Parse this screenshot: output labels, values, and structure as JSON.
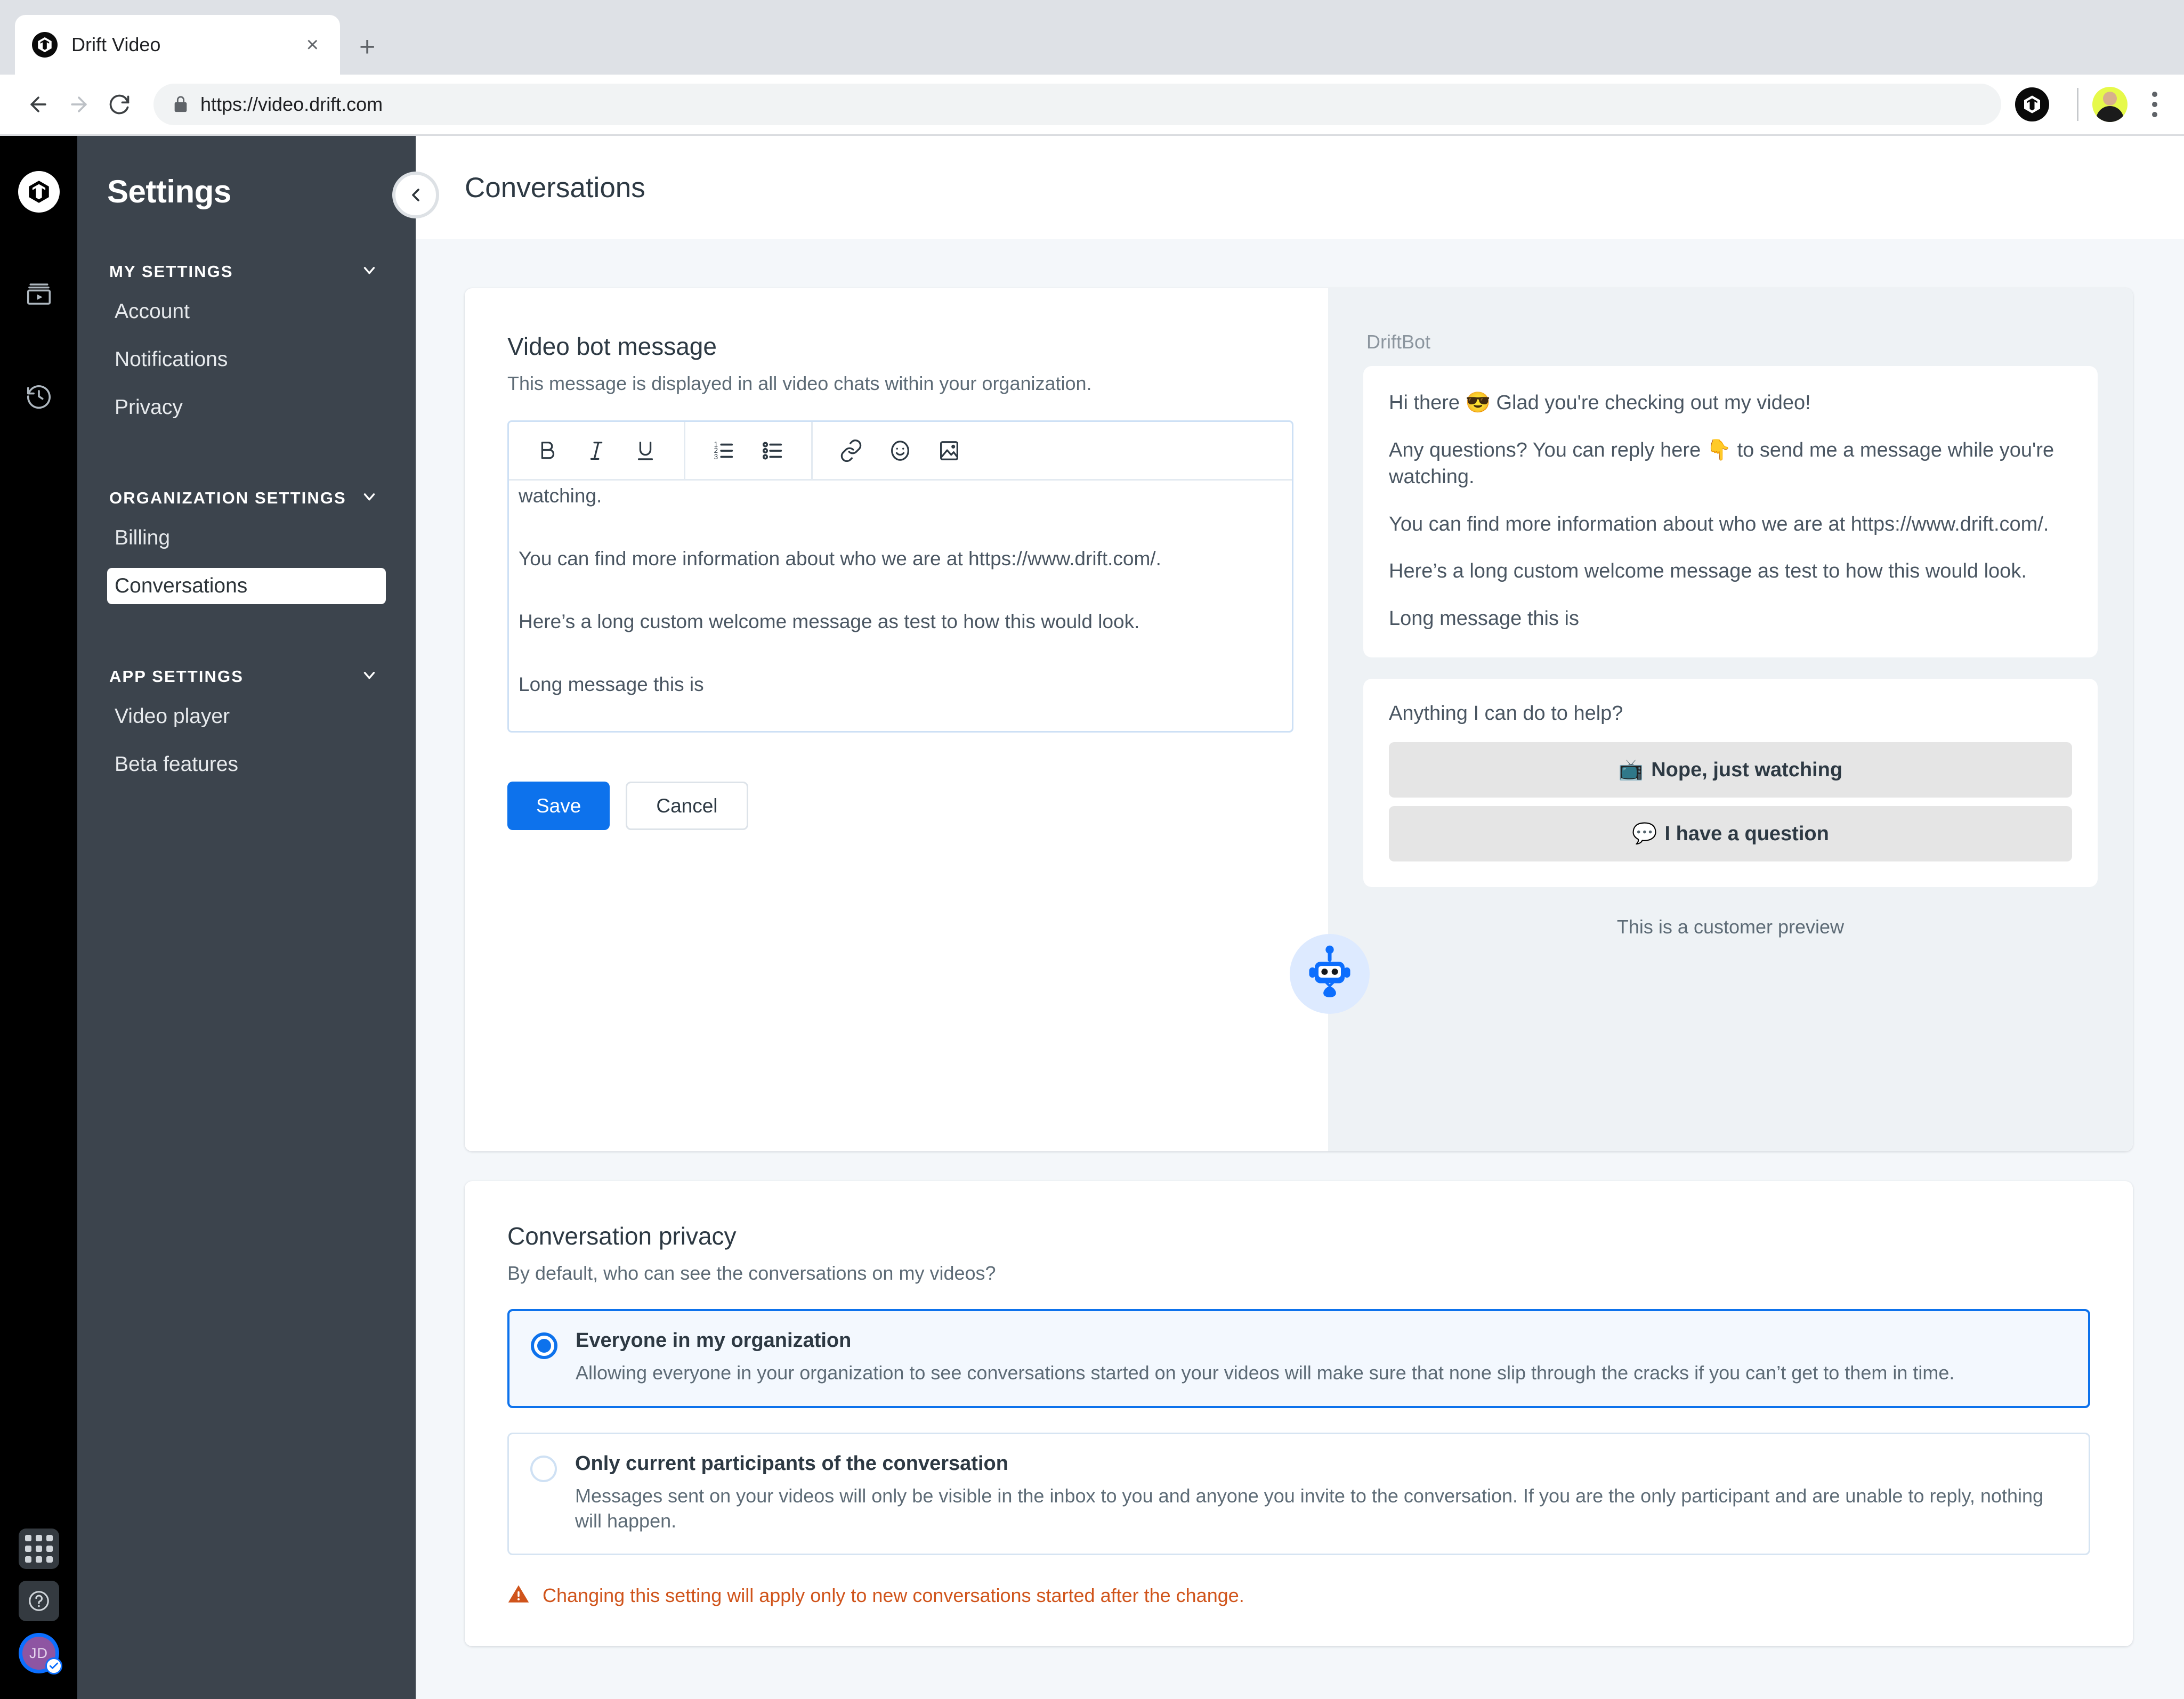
{
  "browser": {
    "tab": {
      "title": "Drift Video",
      "favicon": "drift-logo-icon",
      "close_icon": "close-icon"
    },
    "new_tab_icon": "plus-icon",
    "back_icon": "back-arrow-icon",
    "forward_icon": "forward-arrow-icon",
    "reload_icon": "reload-icon",
    "lock_icon": "lock-icon",
    "url": "https://video.drift.com",
    "extension_icon": "drift-extension-icon",
    "profile_avatar": "user-photo-avatar",
    "menu_icon": "kebab-menu-icon"
  },
  "rail": {
    "logo": "drift-logo-icon",
    "items": [
      {
        "name": "video-library-icon"
      },
      {
        "name": "history-icon"
      }
    ],
    "bottom": {
      "apps_icon": "grid-apps-icon",
      "help_icon": "question-help-icon",
      "avatar_initials": "JD",
      "avatar_badge_icon": "check-badge-icon"
    }
  },
  "sidebar": {
    "title": "Settings",
    "collapse_icon": "chevron-left-icon",
    "groups": [
      {
        "label": "MY SETTINGS",
        "chevron": "chevron-down-icon",
        "items": [
          {
            "label": "Account",
            "active": false
          },
          {
            "label": "Notifications",
            "active": false
          },
          {
            "label": "Privacy",
            "active": false
          }
        ]
      },
      {
        "label": "ORGANIZATION SETTINGS",
        "chevron": "chevron-down-icon",
        "items": [
          {
            "label": "Billing",
            "active": false
          },
          {
            "label": "Conversations",
            "active": true
          }
        ]
      },
      {
        "label": "APP SETTINGS",
        "chevron": "chevron-down-icon",
        "items": [
          {
            "label": "Video player",
            "active": false
          },
          {
            "label": "Beta features",
            "active": false
          }
        ]
      }
    ]
  },
  "page": {
    "title": "Conversations"
  },
  "bot_message": {
    "heading": "Video bot message",
    "subheading": "This message is displayed in all video chats within your organization.",
    "toolbar": [
      {
        "name": "bold-icon",
        "label": "B"
      },
      {
        "name": "italic-icon",
        "label": "I"
      },
      {
        "name": "underline-icon",
        "label": "U"
      },
      {
        "name": "ordered-list-icon",
        "label": ""
      },
      {
        "name": "bullet-list-icon",
        "label": ""
      },
      {
        "name": "link-icon",
        "label": ""
      },
      {
        "name": "emoji-icon",
        "label": ""
      },
      {
        "name": "image-icon",
        "label": ""
      }
    ],
    "editor_lines": [
      "watching.",
      "You can find more information about who we are at https://www.drift.com/.",
      "Here’s a long custom welcome message as test to how this would look.",
      "Long message this is"
    ],
    "save_label": "Save",
    "cancel_label": "Cancel"
  },
  "preview": {
    "bot_name": "DriftBot",
    "bot_avatar_icon": "driftbot-robot-icon",
    "message_paragraphs": [
      "Hi there 😎 Glad you're checking out my video!",
      "Any questions? You can reply here 👇 to send me a message while you're watching.",
      "You can find more information about who we are at https://www.drift.com/.",
      "Here’s a long custom welcome message as test to how this would look.",
      "Long message this is"
    ],
    "prompt": "Anything I can do to help?",
    "replies": [
      {
        "emoji": "📺",
        "label": "Nope, just watching"
      },
      {
        "emoji": "💬",
        "label": "I have a question"
      }
    ],
    "footer": "This is a customer preview"
  },
  "privacy": {
    "heading": "Conversation privacy",
    "subheading": "By default, who can see the conversations on my videos?",
    "options": [
      {
        "title": "Everyone in my organization",
        "desc": "Allowing everyone in your organization to see conversations started on your videos will make sure that none slip through the cracks if you can’t get to them in time.",
        "selected": true
      },
      {
        "title": "Only current participants of the conversation",
        "desc": "Messages sent on your videos will only be visible in the inbox to you and anyone you invite to the conversation. If you are the only participant and are unable to reply, nothing will happen.",
        "selected": false
      }
    ],
    "warning_icon": "warning-triangle-icon",
    "warning": "Changing this setting will apply only to new conversations started after the change.",
    "accent_color": "#0d72ec",
    "warning_color": "#d0541b"
  }
}
